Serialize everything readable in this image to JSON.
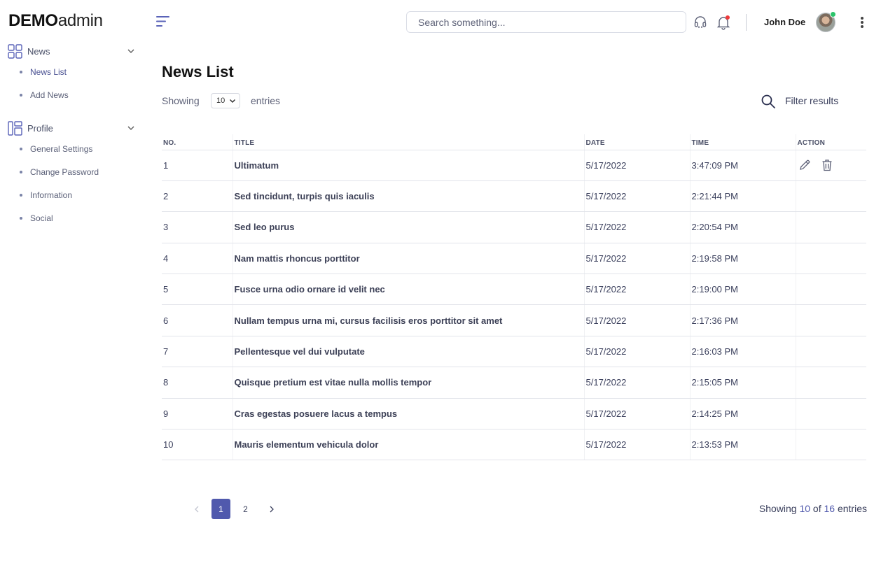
{
  "brand": {
    "bold": "DEMO",
    "light": "admin"
  },
  "sidebar": {
    "groups": [
      {
        "label": "News",
        "icon": "grid-icon",
        "items": [
          {
            "label": "News List",
            "active": true
          },
          {
            "label": "Add News",
            "active": false
          }
        ]
      },
      {
        "label": "Profile",
        "icon": "layout-icon",
        "items": [
          {
            "label": "General Settings",
            "active": false
          },
          {
            "label": "Change Password",
            "active": false
          },
          {
            "label": "Information",
            "active": false
          },
          {
            "label": "Social",
            "active": false
          }
        ]
      }
    ]
  },
  "header": {
    "search_placeholder": "Search something...",
    "search_value": "",
    "user_name": "John Doe",
    "user_status": "online",
    "notification_badge_color": "#f03a3a"
  },
  "main": {
    "title": "News List",
    "showing_label": "Showing",
    "entries_value": "10",
    "entries_label": "entries",
    "filter_label": "Filter results",
    "table": {
      "columns": [
        "NO.",
        "TITLE",
        "DATE",
        "TIME",
        "ACTION"
      ],
      "rows": [
        {
          "no": "1",
          "title": "Ultimatum",
          "date": "5/17/2022",
          "time": "3:47:09 PM",
          "actions": true
        },
        {
          "no": "2",
          "title": "Sed tincidunt, turpis quis iaculis",
          "date": "5/17/2022",
          "time": "2:21:44 PM",
          "actions": false
        },
        {
          "no": "3",
          "title": "Sed leo purus",
          "date": "5/17/2022",
          "time": "2:20:54 PM",
          "actions": false
        },
        {
          "no": "4",
          "title": "Nam mattis rhoncus porttitor",
          "date": "5/17/2022",
          "time": "2:19:58 PM",
          "actions": false
        },
        {
          "no": "5",
          "title": "Fusce urna odio ornare id velit nec",
          "date": "5/17/2022",
          "time": "2:19:00 PM",
          "actions": false
        },
        {
          "no": "6",
          "title": "Nullam tempus urna mi, cursus facilisis eros porttitor sit amet",
          "date": "5/17/2022",
          "time": "2:17:36 PM",
          "actions": false
        },
        {
          "no": "7",
          "title": "Pellentesque vel dui vulputate",
          "date": "5/17/2022",
          "time": "2:16:03 PM",
          "actions": false
        },
        {
          "no": "8",
          "title": "Quisque pretium est vitae nulla mollis tempor",
          "date": "5/17/2022",
          "time": "2:15:05 PM",
          "actions": false
        },
        {
          "no": "9",
          "title": "Cras egestas posuere lacus a tempus",
          "date": "5/17/2022",
          "time": "2:14:25 PM",
          "actions": false
        },
        {
          "no": "10",
          "title": "Mauris elementum vehicula dolor",
          "date": "5/17/2022",
          "time": "2:13:53 PM",
          "actions": false
        }
      ]
    }
  },
  "pagination": {
    "pages": [
      "1",
      "2"
    ],
    "current": "1",
    "info_prefix": "Showing",
    "info_count": "10",
    "info_mid": "of",
    "info_total": "16",
    "info_suffix": "entries"
  },
  "colors": {
    "accent": "#5059ad",
    "icon": "#5a63b8",
    "online": "#2bc46b"
  }
}
